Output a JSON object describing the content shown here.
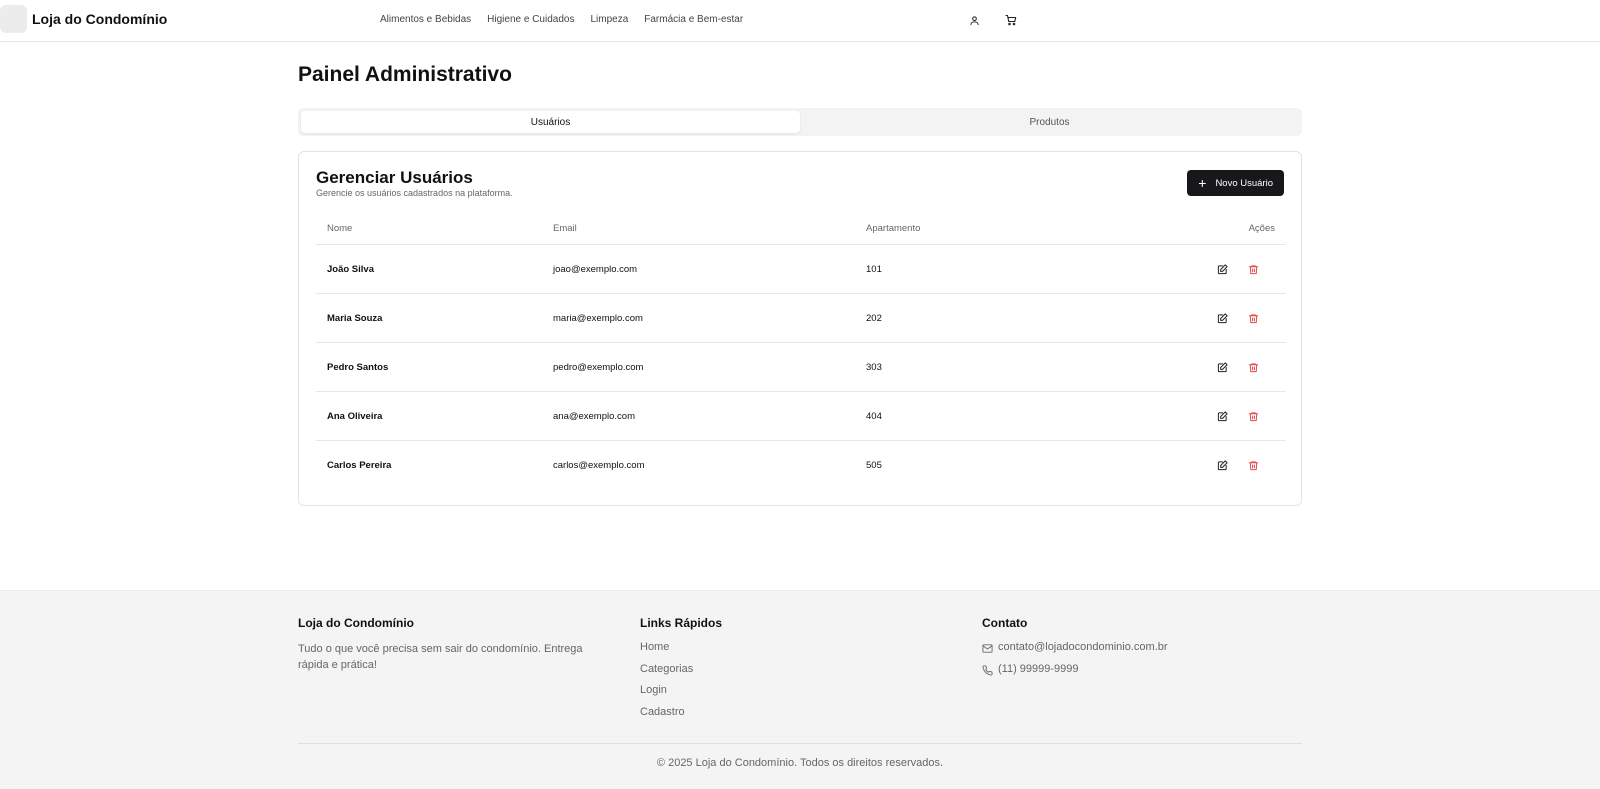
{
  "header": {
    "brand": "Loja do Condomínio",
    "nav": [
      "Alimentos e Bebidas",
      "Higiene e Cuidados",
      "Limpeza",
      "Farmácia e Bem-estar"
    ],
    "icons": [
      "user-icon",
      "cart-icon"
    ]
  },
  "page": {
    "title": "Painel Administrativo",
    "tabs": [
      "Usuários",
      "Produtos"
    ],
    "active_tab": "Usuários"
  },
  "users_card": {
    "title": "Gerenciar Usuários",
    "subtitle": "Gerencie os usuários cadastrados na plataforma.",
    "new_button": "Novo Usuário",
    "columns": [
      "Nome",
      "Email",
      "Apartamento",
      "Ações"
    ],
    "rows": [
      {
        "name": "João Silva",
        "email": "joao@exemplo.com",
        "apartment": "101"
      },
      {
        "name": "Maria Souza",
        "email": "maria@exemplo.com",
        "apartment": "202"
      },
      {
        "name": "Pedro Santos",
        "email": "pedro@exemplo.com",
        "apartment": "303"
      },
      {
        "name": "Ana Oliveira",
        "email": "ana@exemplo.com",
        "apartment": "404"
      },
      {
        "name": "Carlos Pereira",
        "email": "carlos@exemplo.com",
        "apartment": "505"
      }
    ],
    "row_action_icons": [
      "edit-icon",
      "trash-icon"
    ]
  },
  "footer": {
    "about": {
      "title": "Loja do Condomínio",
      "text": "Tudo o que você precisa sem sair do condomínio. Entrega rápida e prática!"
    },
    "links": {
      "title": "Links Rápidos",
      "items": [
        "Home",
        "Categorias",
        "Login",
        "Cadastro"
      ]
    },
    "contact": {
      "title": "Contato",
      "email": "contato@lojadocondominio.com.br",
      "phone": "(11) 99999-9999"
    },
    "copyright": "© 2025 Loja do Condomínio. Todos os direitos reservados."
  },
  "colors": {
    "primary_button": "#18181b",
    "delete_icon": "#e5484d",
    "footer_bg": "#f4f4f4",
    "tab_bg": "#f3f3f3"
  }
}
